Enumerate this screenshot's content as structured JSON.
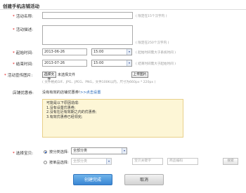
{
  "page_title": "创建手机店铺活动",
  "form": {
    "activity_name": {
      "label": "活动名称:",
      "value": "",
      "hint": "( 限定在15个汉字内 )"
    },
    "activity_desc": {
      "label": "活动描述:",
      "value": "",
      "hint": "( 限定在250个汉字内 )"
    },
    "start_time": {
      "label": "起始时间:",
      "date": "2013-06-26",
      "time": "15:00",
      "hint": "( 起始时间需大于系统时间 )"
    },
    "end_time": {
      "label": "结束时间:",
      "date": "2013-07-26",
      "time": "15:00",
      "hint": "( 结束时间需大于起始时间 )"
    },
    "promo_image": {
      "label": "活动宣传图片:",
      "choose_button": "选择文件",
      "no_file_text": "未选择文件",
      "upload_button": "上传图片",
      "hint": "( 文件格式GIF、JPG、JPEG、PNG，文件100K以内，尺寸为660px * 220px )"
    },
    "coupon": {
      "label": "店铺优惠券:",
      "text": "没有有效的店铺优惠券!",
      "link": ">>点击设置"
    },
    "notice": {
      "title": "可能是以下原因造成:",
      "lines": [
        "1.没有设置优惠券;",
        "2.没有在近有效期之内的优惠券;",
        "3.有效优惠券已经领完;"
      ]
    },
    "products": {
      "label": "选择宝贝:",
      "by_category_label": "按分类选择:",
      "category_value": "全部分类",
      "by_product_label": "按单品选择:",
      "product_category_value": "全部分类",
      "name_placeholder": "宝贝关键字",
      "code_placeholder": "商品编码",
      "search_button": "搜索"
    }
  },
  "actions": {
    "submit": "创建完成",
    "cancel": "取消"
  },
  "colors": {
    "primary": "#3a86d4",
    "notice_bg": "#fdf6d6",
    "link": "#1a5fb4",
    "required": "#dd0000"
  }
}
